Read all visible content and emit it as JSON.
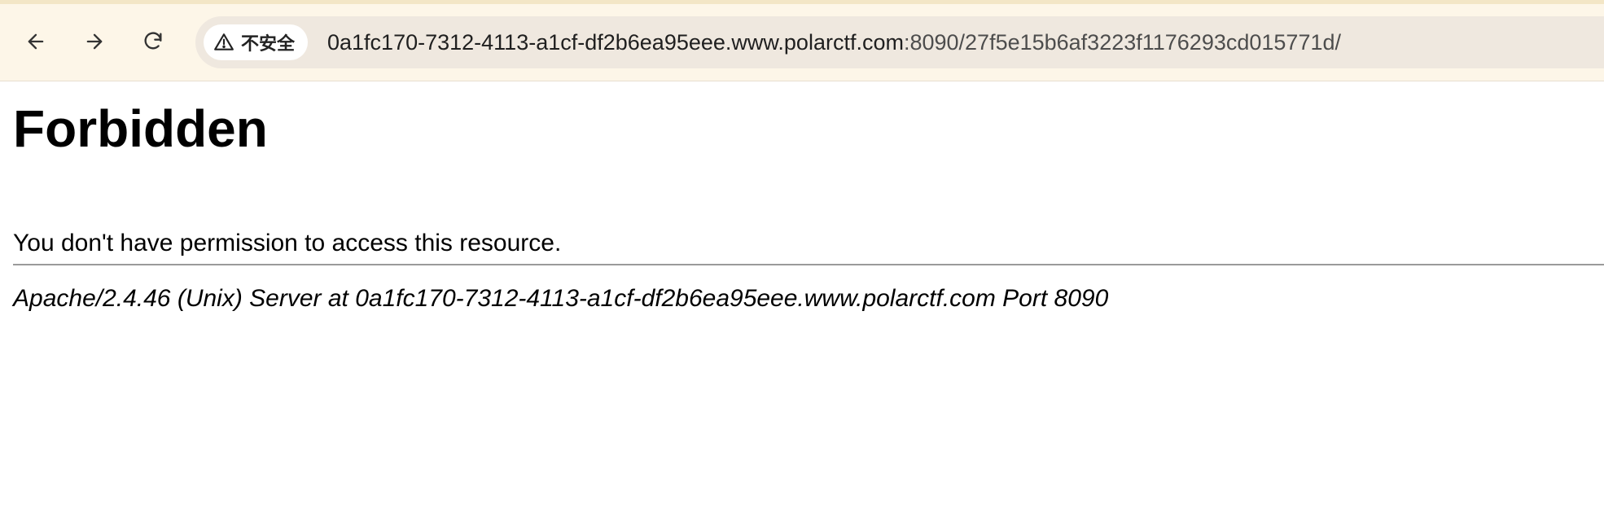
{
  "browser": {
    "security_label": "不安全",
    "url_host": "0a1fc170-7312-4113-a1cf-df2b6ea95eee.www.polarctf.com",
    "url_rest": ":8090/27f5e15b6af3223f1176293cd015771d/",
    "icons": {
      "back": "arrow-left-icon",
      "forward": "arrow-right-icon",
      "reload": "reload-icon",
      "security": "warning-icon"
    }
  },
  "page": {
    "heading": "Forbidden",
    "message": "You don't have permission to access this resource.",
    "server_signature": "Apache/2.4.46 (Unix) Server at 0a1fc170-7312-4113-a1cf-df2b6ea95eee.www.polarctf.com Port 8090"
  },
  "colors": {
    "toolbar_bg": "#fdf6e8",
    "omnibox_bg": "#efe8df",
    "text": "#000000"
  }
}
